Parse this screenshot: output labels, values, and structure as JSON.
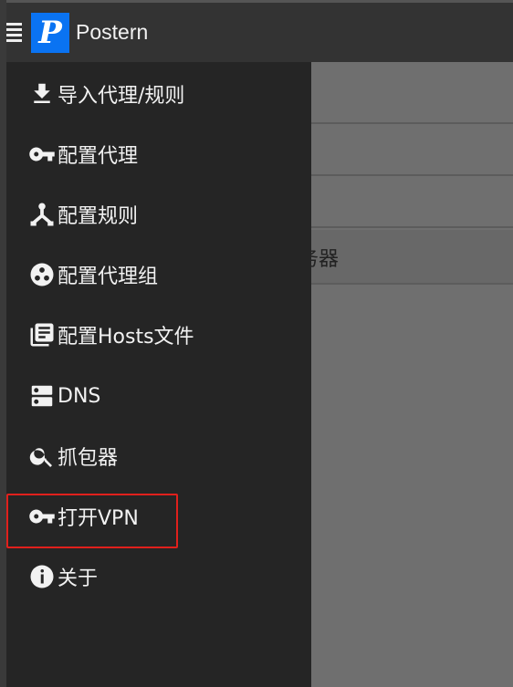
{
  "app": {
    "title": "Postern",
    "logo_letter": "P"
  },
  "background": {
    "partial_text": "务器"
  },
  "drawer": {
    "items": [
      {
        "label": "导入代理/规则",
        "icon": "download-icon"
      },
      {
        "label": "配置代理",
        "icon": "key-icon"
      },
      {
        "label": "配置规则",
        "icon": "rules-tree-icon"
      },
      {
        "label": "配置代理组",
        "icon": "group-icon"
      },
      {
        "label": "配置Hosts文件",
        "icon": "library-icon"
      },
      {
        "label": "DNS",
        "icon": "dns-icon"
      },
      {
        "label": "抓包器",
        "icon": "search-icon"
      },
      {
        "label": "打开VPN",
        "icon": "key-icon"
      },
      {
        "label": "关于",
        "icon": "info-icon"
      }
    ]
  },
  "colors": {
    "accent": "#0a73f2",
    "highlight": "#e0201c"
  }
}
